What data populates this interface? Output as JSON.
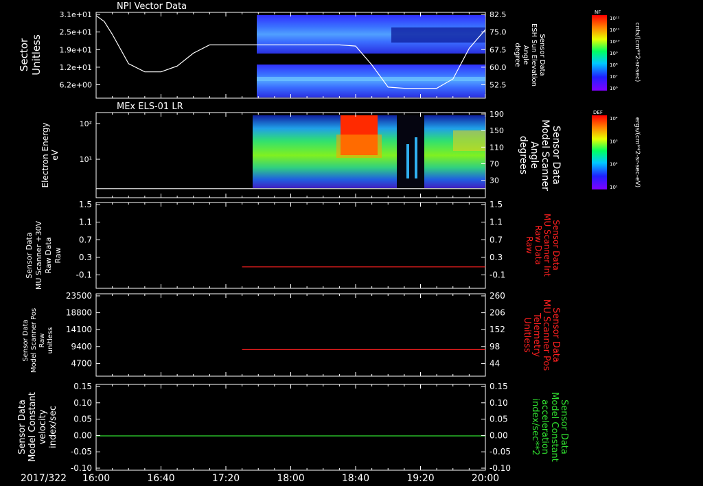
{
  "colors": {
    "background": "#000000",
    "frame": "#ffffff",
    "red": "#ff2020",
    "green": "#30e030"
  },
  "time_axis": {
    "date_label": "2017/322",
    "ticks": [
      "16:00",
      "16:40",
      "17:20",
      "18:00",
      "18:40",
      "19:20",
      "20:00"
    ]
  },
  "colorbars": [
    {
      "label": "NF",
      "units": "cnts/(cm**2-sr-sec)",
      "ticks": [
        "10¹²",
        "10¹¹",
        "10¹⁰",
        "10⁹",
        "10⁸",
        "10⁷",
        "10⁶"
      ]
    },
    {
      "label": "DEF",
      "units": "ergs/(cm**2-sr-sec-eV)",
      "ticks": [
        "10⁴",
        "10³",
        "10²",
        "10¹"
      ]
    }
  ],
  "chart_data": [
    {
      "type": "heatmap",
      "title": "NPI Vector Data",
      "ylabel_lines": [
        "Sector",
        "Unitless"
      ],
      "yticks": [
        "3.1e+01",
        "2.5e+01",
        "1.9e+01",
        "1.2e+01",
        "6.2e+00"
      ],
      "right_label_lines": [
        "Sensor Data",
        "ESH Sun Elevation",
        "Angle",
        "degree"
      ],
      "right_ticks": [
        "82.5",
        "75.0",
        "67.5",
        "60.0",
        "52.5"
      ],
      "overlay_line": {
        "x": [
          "16:00",
          "16:05",
          "16:10",
          "16:20",
          "16:30",
          "16:40",
          "16:50",
          "17:00",
          "17:10",
          "17:20",
          "17:30",
          "17:40",
          "17:50",
          "18:00",
          "18:10",
          "18:20",
          "18:30",
          "18:40",
          "18:50",
          "19:00",
          "19:10",
          "19:20",
          "19:30",
          "19:40",
          "19:50",
          "20:00"
        ],
        "y": [
          82.0,
          79.5,
          74.0,
          61.5,
          58.0,
          58.0,
          60.5,
          66.0,
          69.5,
          69.5,
          69.5,
          69.5,
          69.5,
          69.5,
          69.5,
          69.5,
          69.5,
          69.0,
          61.0,
          51.5,
          51.0,
          51.0,
          51.0,
          55.0,
          68.0,
          76.0
        ]
      }
    },
    {
      "type": "heatmap",
      "title": "MEx ELS-01 LR",
      "ylabel_lines": [
        "Electron Energy",
        "eV"
      ],
      "yticks": [
        "10²",
        "10¹"
      ],
      "right_label_lines": [
        "Sensor Data",
        "Model Scanner",
        "Angle",
        "degrees"
      ],
      "right_ticks": [
        "190",
        "150",
        "110",
        "70",
        "30"
      ],
      "overlay_line": {
        "x": [
          "16:00",
          "20:00"
        ],
        "y": [
          10,
          10
        ]
      }
    },
    {
      "type": "line",
      "ylabel_lines": [
        "Sensor Data",
        "MU Scanner +30V",
        "Raw Data",
        "Raw"
      ],
      "yticks": [
        "1.5",
        "1.1",
        "0.7",
        "0.3",
        "-0.1"
      ],
      "right_label_lines": [
        "Sensor Data",
        "MU Scanner Int",
        "Raw Data",
        "Raw"
      ],
      "right_ticks": [
        "1.5",
        "1.1",
        "0.7",
        "0.3",
        "-0.1"
      ],
      "ylim": [
        -0.5,
        1.5
      ],
      "series": [
        {
          "x": [
            "17:30",
            "20:00"
          ],
          "y": [
            0.0,
            0.0
          ]
        }
      ]
    },
    {
      "type": "line",
      "ylabel_lines": [
        "Sensor Data",
        "Model Scanner Pos",
        "Raw",
        "unitless"
      ],
      "yticks": [
        "23500",
        "18800",
        "14100",
        "9400",
        "4700"
      ],
      "right_label_lines": [
        "Sensor Data",
        "MU Scanner Pos",
        "Telemetry",
        "Unitless"
      ],
      "right_ticks": [
        "260",
        "206",
        "152",
        "98",
        "44"
      ],
      "ylim": [
        -4,
        260
      ],
      "series": [
        {
          "x": [
            "17:30",
            "20:00"
          ],
          "y": [
            81,
            81
          ]
        }
      ]
    },
    {
      "type": "line",
      "ylabel_lines": [
        "Sensor Data",
        "Model Constant",
        "velocity",
        "index/sec"
      ],
      "yticks": [
        "0.15",
        "0.10",
        "0.05",
        "0.00",
        "-0.05",
        "-0.10"
      ],
      "right_label_lines": [
        "Sensor Data",
        "Model Constant",
        "acceleration",
        "index/sec**2"
      ],
      "right_ticks": [
        "0.15",
        "0.10",
        "0.05",
        "0.00",
        "-0.05",
        "-0.10"
      ],
      "ylim": [
        -0.1,
        0.15
      ],
      "series": [
        {
          "x": [
            "16:00",
            "20:00"
          ],
          "y": [
            0.0,
            0.0
          ]
        }
      ]
    }
  ]
}
